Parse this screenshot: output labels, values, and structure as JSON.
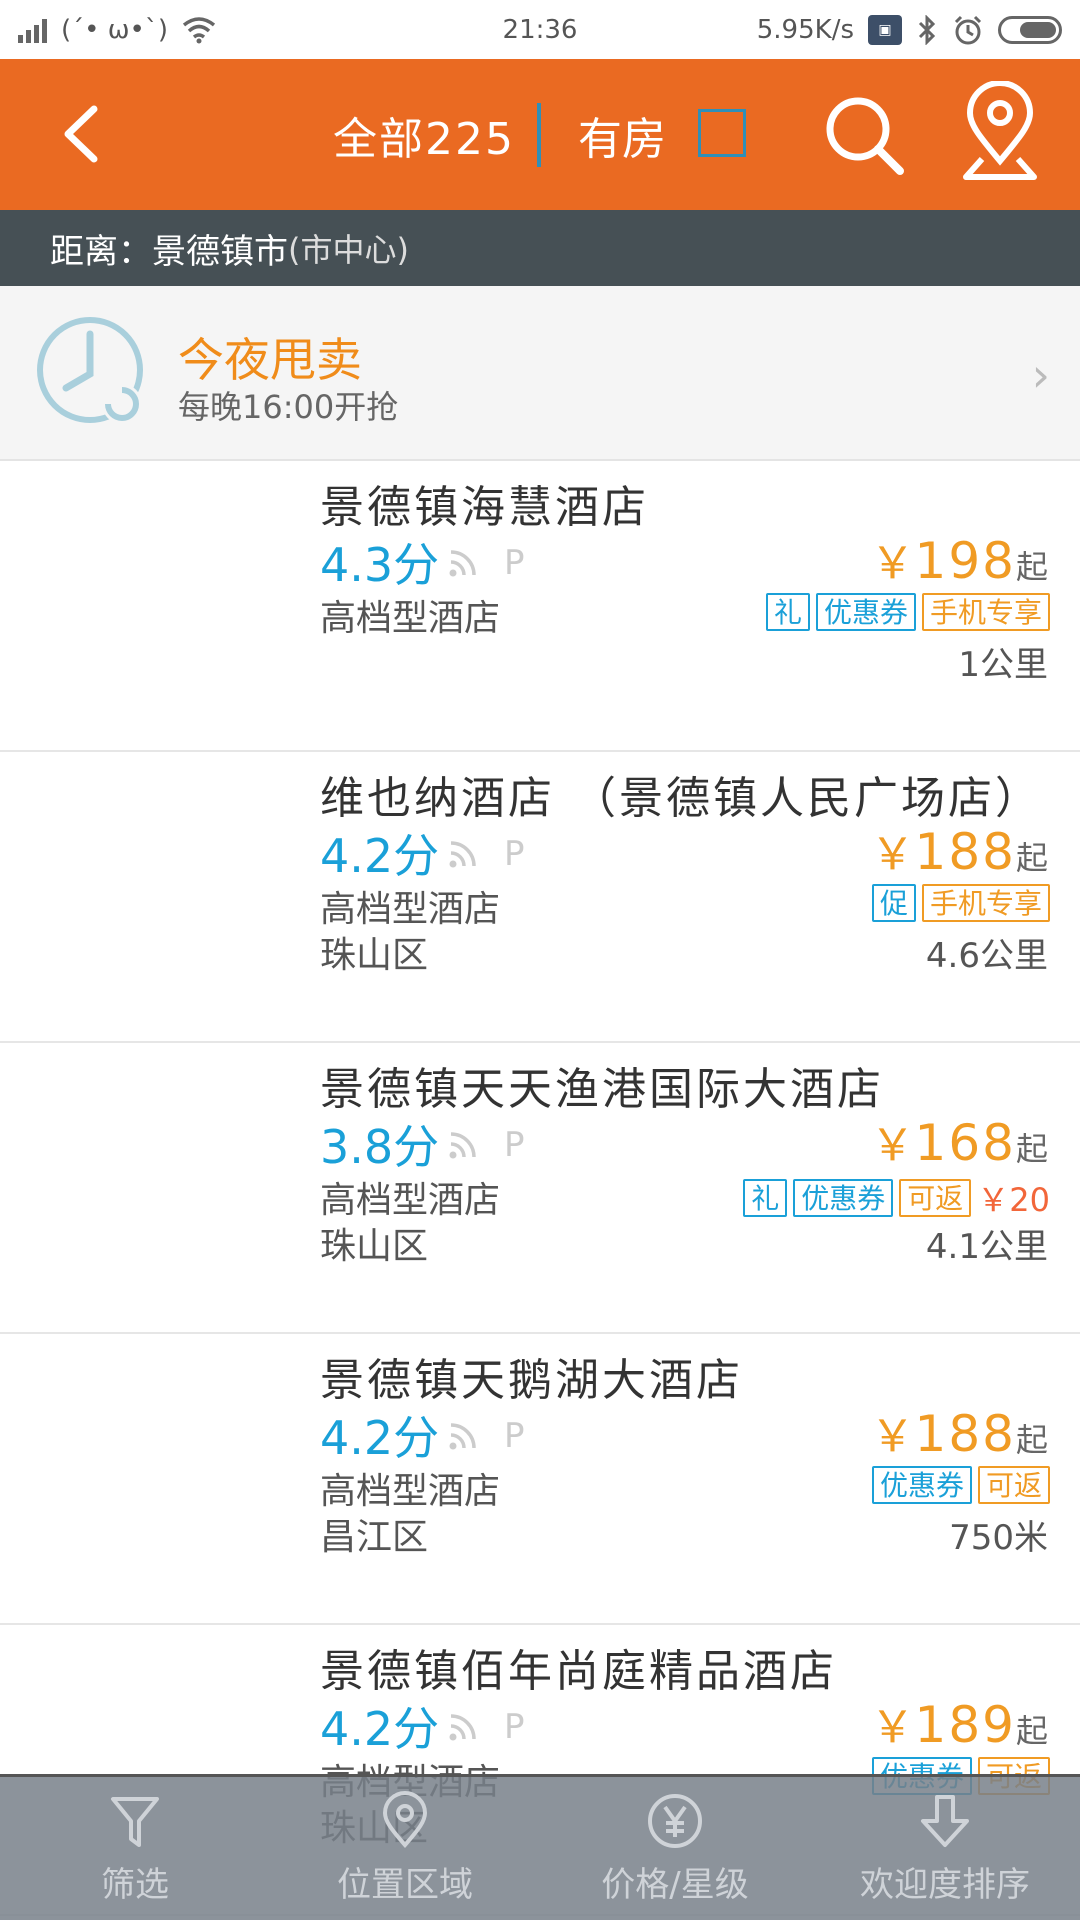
{
  "status_bar": {
    "emoticon": "(´• ω•`)",
    "time": "21:36",
    "net_speed": "5.95K/s"
  },
  "header": {
    "all_label": "全部225",
    "available_label": "有房",
    "available_checked": false
  },
  "distance": {
    "label": "距离：景德镇市",
    "sub": "(市中心)"
  },
  "promo": {
    "title": "今夜甩卖",
    "subtitle": "每晚16:00开抢",
    "chevron": "›"
  },
  "hotels": [
    {
      "name": "景德镇海慧酒店",
      "score": "4.3分",
      "parking": "P",
      "type": "高档型酒店",
      "district": "",
      "price_yen": "￥",
      "price": "198",
      "price_suffix": "起",
      "tags": [
        {
          "text": "礼",
          "color": "blue"
        },
        {
          "text": "优惠券",
          "color": "blue"
        },
        {
          "text": "手机专享",
          "color": "orange"
        }
      ],
      "tag_extra": "",
      "distance": "1公里"
    },
    {
      "name": "维也纳酒店 （景德镇人民广场店）",
      "score": "4.2分",
      "parking": "P",
      "type": "高档型酒店",
      "district": "珠山区",
      "price_yen": "￥",
      "price": "188",
      "price_suffix": "起",
      "tags": [
        {
          "text": "促",
          "color": "blue"
        },
        {
          "text": "手机专享",
          "color": "orange"
        }
      ],
      "tag_extra": "",
      "distance": "4.6公里"
    },
    {
      "name": "景德镇天天渔港国际大酒店",
      "score": "3.8分",
      "parking": "P",
      "type": "高档型酒店",
      "district": "珠山区",
      "price_yen": "￥",
      "price": "168",
      "price_suffix": "起",
      "tags": [
        {
          "text": "礼",
          "color": "blue"
        },
        {
          "text": "优惠券",
          "color": "blue"
        },
        {
          "text": "可返",
          "color": "orange"
        }
      ],
      "tag_extra": "￥20",
      "distance": "4.1公里"
    },
    {
      "name": "景德镇天鹅湖大酒店",
      "score": "4.2分",
      "parking": "P",
      "type": "高档型酒店",
      "district": "昌江区",
      "price_yen": "￥",
      "price": "188",
      "price_suffix": "起",
      "tags": [
        {
          "text": "优惠券",
          "color": "blue"
        },
        {
          "text": "可返",
          "color": "orange"
        }
      ],
      "tag_extra": "",
      "distance": "750米"
    },
    {
      "name": "景德镇佰年尚庭精品酒店",
      "score": "4.2分",
      "parking": "P",
      "type": "高档型酒店",
      "district": "珠山区",
      "price_yen": "￥",
      "price": "189",
      "price_suffix": "起",
      "tags": [
        {
          "text": "优惠券",
          "color": "blue"
        },
        {
          "text": "可返",
          "color": "orange"
        }
      ],
      "tag_extra": "",
      "distance": ""
    }
  ],
  "tabbar": [
    {
      "label": "筛选",
      "icon": "filter-icon"
    },
    {
      "label": "位置区域",
      "icon": "location-pin-icon"
    },
    {
      "label": "价格/星级",
      "icon": "yen-icon"
    },
    {
      "label": "欢迎度排序",
      "icon": "sort-down-icon"
    }
  ],
  "colors": {
    "header_bg": "#ea6a22",
    "score_blue": "#1aa0d8",
    "price_orange": "#f09b24",
    "distance_bar_bg": "#465055"
  }
}
